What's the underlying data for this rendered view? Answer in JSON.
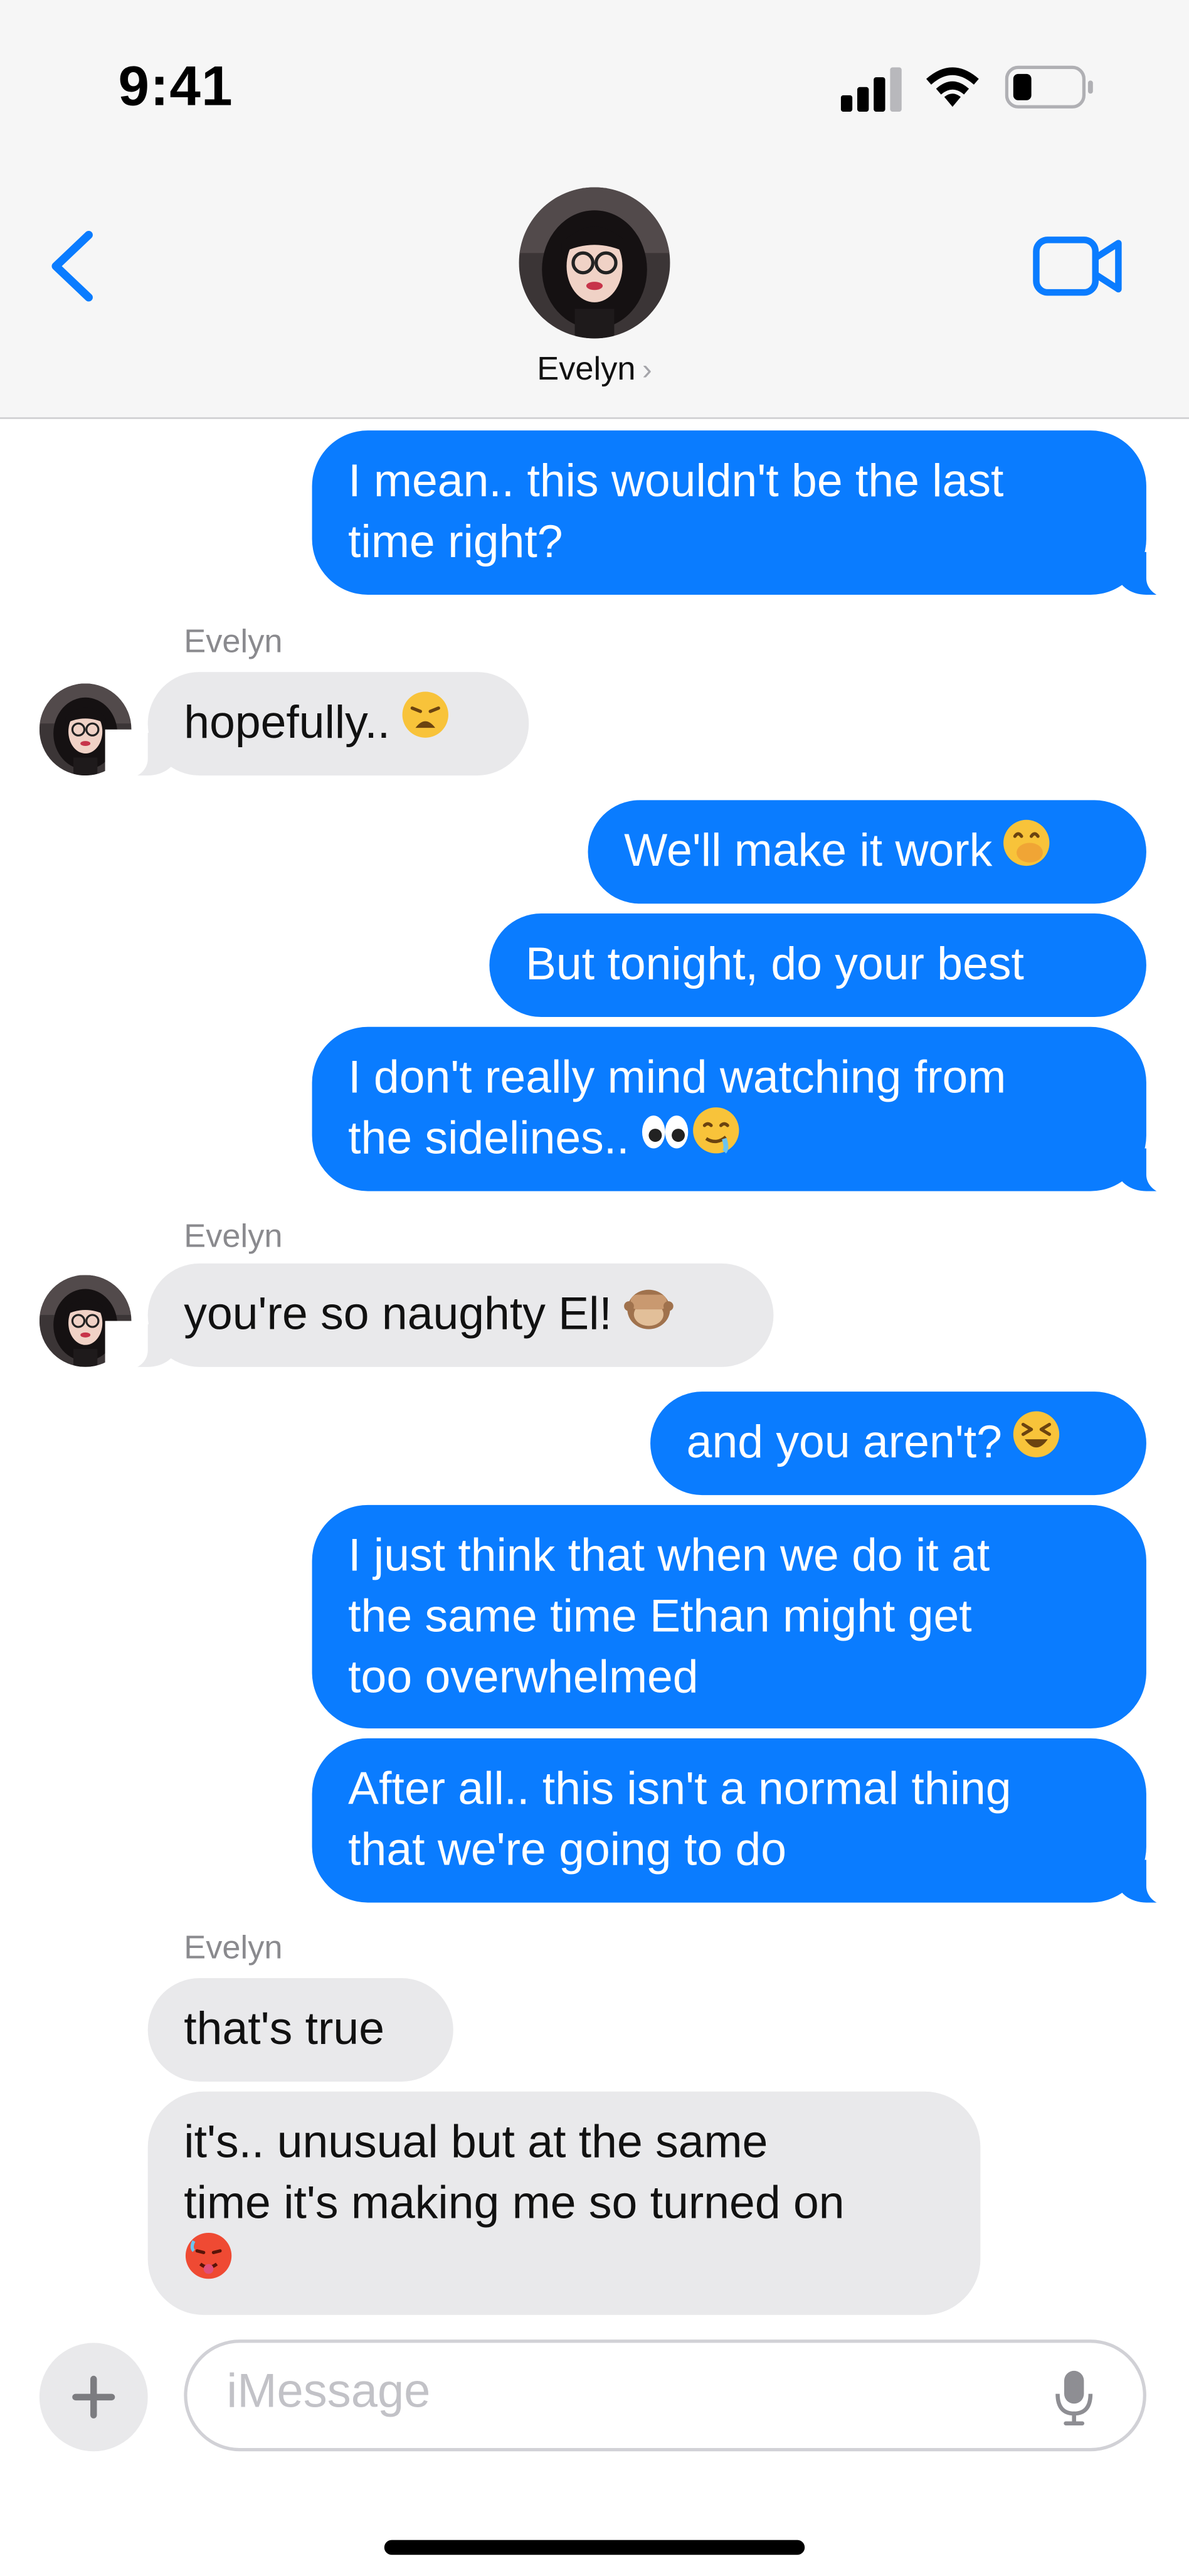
{
  "status_bar": {
    "time": "9:41"
  },
  "header": {
    "contact_name": "Evelyn",
    "chevron": "›"
  },
  "messages": [
    {
      "direction": "out",
      "lines": [
        "I mean.. this wouldn't be the last",
        "time right?"
      ],
      "emoji": []
    },
    {
      "direction": "in",
      "sender": "Evelyn",
      "lines": [
        "hopefully.."
      ],
      "emoji": [
        "weary-face"
      ]
    },
    {
      "direction": "out",
      "lines": [
        "We'll make it work"
      ],
      "emoji": [
        "hand-over-mouth-face"
      ]
    },
    {
      "direction": "out",
      "lines": [
        "But tonight, do your best"
      ],
      "emoji": []
    },
    {
      "direction": "out",
      "lines": [
        "I don't really mind watching from",
        "the sidelines.."
      ],
      "emoji": [
        "eyes",
        "drooling-face"
      ]
    },
    {
      "direction": "in",
      "sender": "Evelyn",
      "lines": [
        "you're so naughty El!"
      ],
      "emoji": [
        "see-no-evil-monkey"
      ]
    },
    {
      "direction": "out",
      "lines": [
        "and you aren't?"
      ],
      "emoji": [
        "grinning-squinting-face"
      ]
    },
    {
      "direction": "out",
      "lines": [
        "I just think that when we do it at",
        "the same time Ethan might get",
        "too overwhelmed"
      ],
      "emoji": []
    },
    {
      "direction": "out",
      "lines": [
        "After all.. this isn't a normal thing",
        "that we're going to do"
      ],
      "emoji": []
    },
    {
      "direction": "in",
      "sender": "Evelyn",
      "lines": [
        "that's true"
      ],
      "emoji": []
    },
    {
      "direction": "in",
      "lines": [
        "it's.. unusual but at the same",
        "time it's making me so turned on"
      ],
      "emoji": [
        "hot-face"
      ]
    }
  ],
  "input": {
    "placeholder": "iMessage"
  },
  "colors": {
    "outgoing_bubble": "#0a7cff",
    "incoming_bubble": "#e9e9eb",
    "accent": "#0a7cff",
    "header_bg": "#f6f6f6"
  },
  "icons": [
    "signal-icon",
    "wifi-icon",
    "battery-icon",
    "back-chevron-icon",
    "video-camera-icon",
    "plus-icon",
    "microphone-icon"
  ]
}
